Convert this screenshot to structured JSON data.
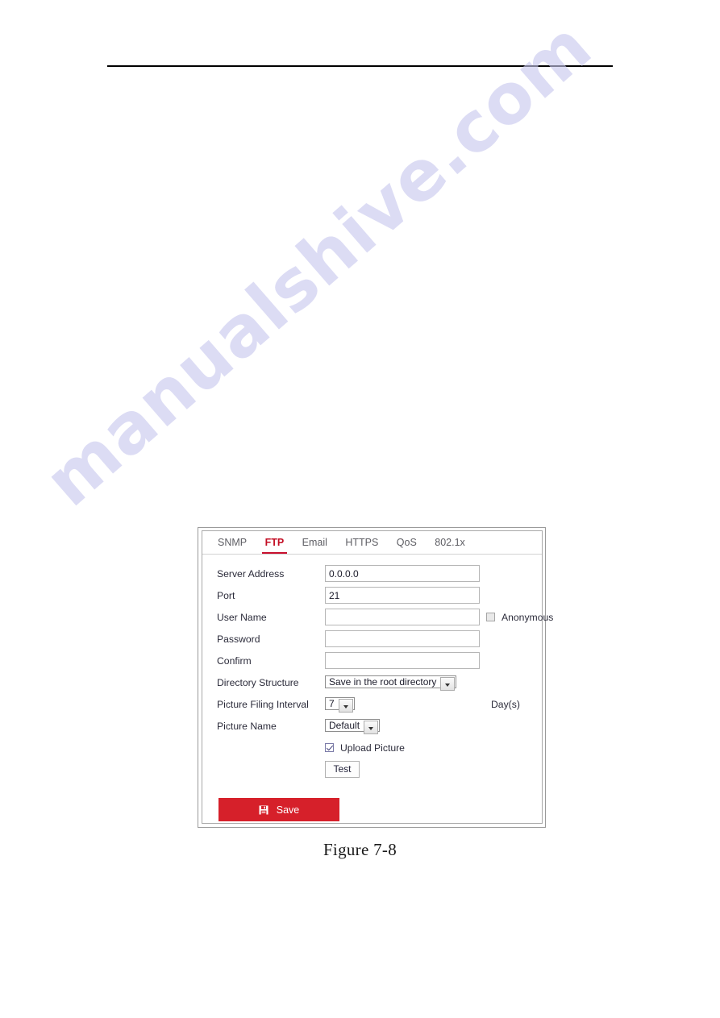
{
  "document": {
    "watermark": "manualshive.com",
    "figure_caption": "Figure 7-8"
  },
  "panel": {
    "tabs": [
      {
        "label": "SNMP",
        "active": false
      },
      {
        "label": "FTP",
        "active": true
      },
      {
        "label": "Email",
        "active": false
      },
      {
        "label": "HTTPS",
        "active": false
      },
      {
        "label": "QoS",
        "active": false
      },
      {
        "label": "802.1x",
        "active": false
      }
    ],
    "fields": {
      "server_address": {
        "label": "Server Address",
        "value": "0.0.0.0"
      },
      "port": {
        "label": "Port",
        "value": "21"
      },
      "user_name": {
        "label": "User Name",
        "value": ""
      },
      "password": {
        "label": "Password",
        "value": ""
      },
      "confirm": {
        "label": "Confirm",
        "value": ""
      },
      "directory_structure": {
        "label": "Directory Structure",
        "value": "Save in the root directory"
      },
      "picture_filing_interval": {
        "label": "Picture Filing Interval",
        "value": "7",
        "suffix": "Day(s)"
      },
      "picture_name": {
        "label": "Picture Name",
        "value": "Default"
      }
    },
    "checkboxes": {
      "anonymous": {
        "label": "Anonymous",
        "checked": false
      },
      "upload_picture": {
        "label": "Upload Picture",
        "checked": true
      }
    },
    "buttons": {
      "test": "Test",
      "save": "Save"
    },
    "colors": {
      "accent": "#c8102e",
      "save_button": "#d6202a",
      "watermark": "#c8c8ee"
    }
  }
}
